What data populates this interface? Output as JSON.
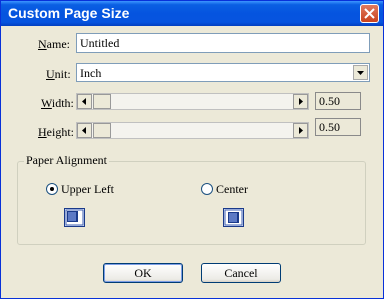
{
  "window": {
    "title": "Custom Page Size"
  },
  "name": {
    "label_prefix": "N",
    "label_rest": "ame:",
    "value": "Untitled"
  },
  "unit": {
    "label_prefix": "U",
    "label_rest": "nit:",
    "value": "Inch"
  },
  "width": {
    "label_prefix": "W",
    "label_rest": "idth:",
    "value": "0.50"
  },
  "height": {
    "label_prefix": "H",
    "label_rest": "eight:",
    "value": "0.50"
  },
  "alignment": {
    "group_label": "Paper Alignment",
    "options": [
      {
        "label": "Upper Left",
        "selected": true
      },
      {
        "label": "Center",
        "selected": false
      }
    ]
  },
  "buttons": {
    "ok": "OK",
    "cancel": "Cancel"
  },
  "icons": {
    "close": "close-icon",
    "dropdown": "chevron-down-icon",
    "scroll_left": "arrow-left-icon",
    "scroll_right": "arrow-right-icon",
    "align_upper_left": "page-upper-left-icon",
    "align_center": "page-center-icon"
  }
}
